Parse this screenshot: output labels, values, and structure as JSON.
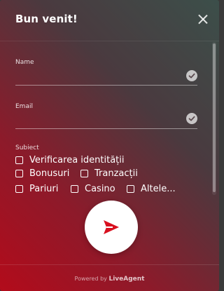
{
  "header": {
    "title": "Bun venit!"
  },
  "form": {
    "name_label": "Name",
    "name_value": "",
    "email_label": "Email",
    "email_value": "",
    "subject_label": "Subiect",
    "options": [
      "Verificarea identității",
      "Bonusuri",
      "Tranzacții",
      "Pariuri",
      "Casino",
      "Altele..."
    ]
  },
  "footer": {
    "powered_prefix": "Powered by",
    "brand": "LiveAgent"
  },
  "colors": {
    "accent": "#c1121f",
    "gradient_top": "#3c4f4a",
    "gradient_bottom": "#b30b1b"
  },
  "icons": {
    "close": "close-icon",
    "check": "check-circle-icon",
    "send": "send-icon"
  }
}
